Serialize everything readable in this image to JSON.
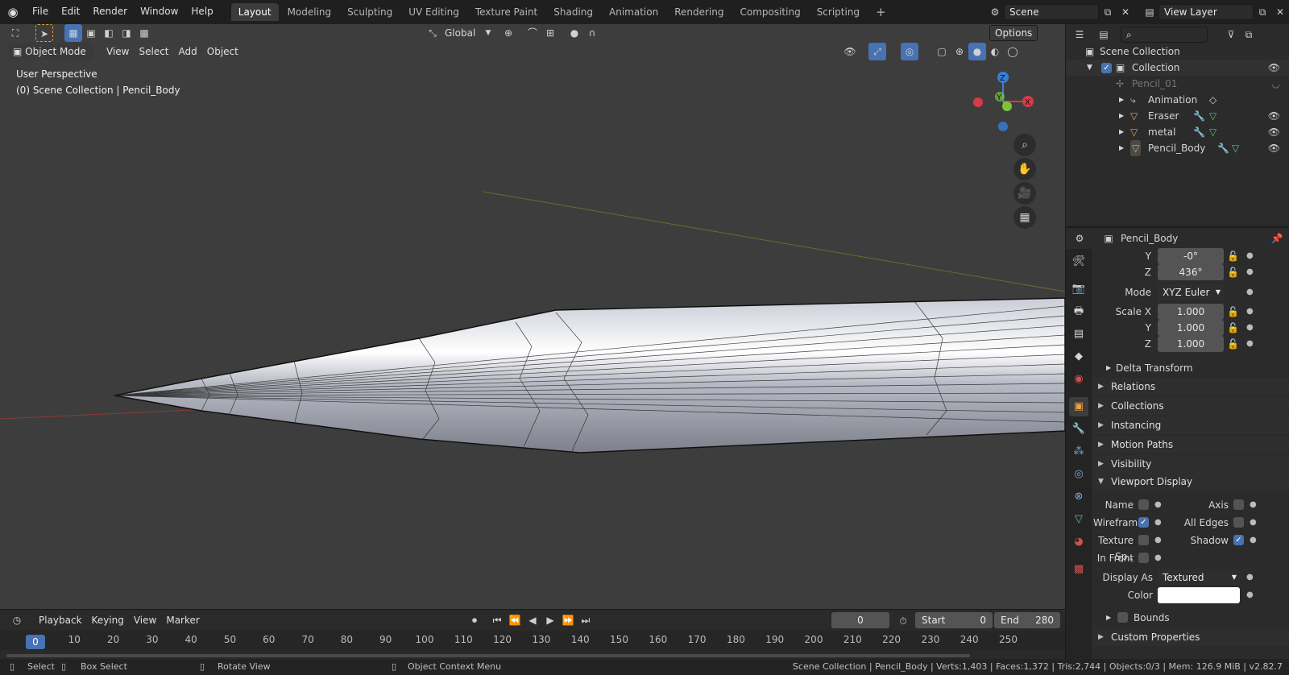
{
  "topbar": {
    "menus": [
      "File",
      "Edit",
      "Render",
      "Window",
      "Help"
    ],
    "workspaces": [
      "Layout",
      "Modeling",
      "Sculpting",
      "UV Editing",
      "Texture Paint",
      "Shading",
      "Animation",
      "Rendering",
      "Compositing",
      "Scripting"
    ],
    "active_workspace": "Layout",
    "scene_value": "Scene",
    "view_layer_value": "View Layer"
  },
  "viewport": {
    "transform_orientation": "Global",
    "options_label": "Options",
    "mode_label": "Object Mode",
    "header_menus": [
      "View",
      "Select",
      "Add",
      "Object"
    ],
    "overlay_title": "User Perspective",
    "overlay_subtitle": "(0) Scene Collection | Pencil_Body",
    "gizmo_axes": {
      "z": "Z",
      "y": "Y",
      "x": "X"
    }
  },
  "timeline": {
    "menus": [
      "Playback",
      "Keying",
      "View",
      "Marker"
    ],
    "current_frame": "0",
    "start_label": "Start",
    "start_value": "0",
    "end_label": "End",
    "end_value": "280",
    "ticks": [
      "0",
      "10",
      "20",
      "30",
      "40",
      "50",
      "60",
      "70",
      "80",
      "90",
      "100",
      "110",
      "120",
      "130",
      "140",
      "150",
      "160",
      "170",
      "180",
      "190",
      "200",
      "210",
      "220",
      "230",
      "240",
      "250"
    ]
  },
  "status": {
    "select": "Select",
    "box_select": "Box Select",
    "rotate_view": "Rotate View",
    "context_menu": "Object Context Menu",
    "info": "Scene Collection | Pencil_Body | Verts:1,403 | Faces:1,372 | Tris:2,744 | Objects:0/3 | Mem: 126.9 MiB | v2.82.7"
  },
  "outliner": {
    "scene_collection": "Scene Collection",
    "collection": "Collection",
    "pencil_parent": "Pencil_01",
    "items": [
      "Animation",
      "Eraser",
      "metal",
      "Pencil_Body"
    ]
  },
  "properties": {
    "object_name": "Pencil_Body",
    "rotation_y_label": "Y",
    "rotation_y": "-0°",
    "rotation_z_label": "Z",
    "rotation_z": "436°",
    "mode_label": "Mode",
    "mode_value": "XYZ Euler",
    "scale_x_label": "Scale X",
    "scale_x": "1.000",
    "scale_y_label": "Y",
    "scale_y": "1.000",
    "scale_z_label": "Z",
    "scale_z": "1.000",
    "delta_transform": "Delta Transform",
    "panels": [
      "Relations",
      "Collections",
      "Instancing",
      "Motion Paths",
      "Visibility"
    ],
    "viewport_display": "Viewport Display",
    "vd_name": "Name",
    "vd_axis": "Axis",
    "vd_wireframe": "Wireframe",
    "vd_all_edges": "All Edges",
    "vd_texture_space": "Texture Sp..",
    "vd_shadow": "Shadow",
    "vd_in_front": "In Front",
    "vd_display_as_label": "Display As",
    "vd_display_as": "Textured",
    "vd_color_label": "Color",
    "vd_bounds": "Bounds",
    "custom_properties": "Custom Properties",
    "checks": {
      "name": false,
      "axis": false,
      "wireframe": true,
      "all_edges": false,
      "texture_space": false,
      "shadow": true,
      "in_front": false,
      "bounds": false
    }
  }
}
